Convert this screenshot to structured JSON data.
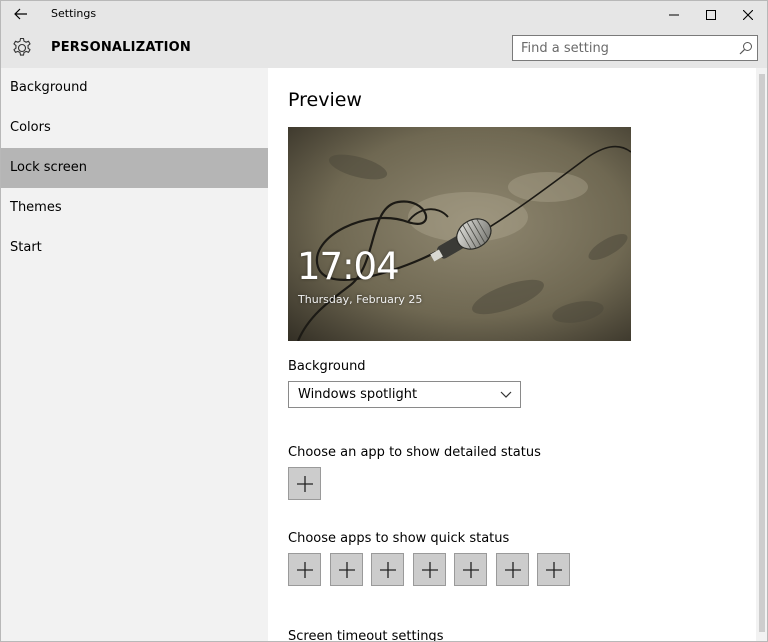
{
  "window": {
    "app_title": "Settings"
  },
  "header": {
    "title": "PERSONALIZATION",
    "search_placeholder": "Find a setting"
  },
  "sidebar": {
    "items": [
      {
        "label": "Background"
      },
      {
        "label": "Colors"
      },
      {
        "label": "Lock screen",
        "selected": true
      },
      {
        "label": "Themes"
      },
      {
        "label": "Start"
      }
    ]
  },
  "main": {
    "preview_heading": "Preview",
    "preview_time": "17:04",
    "preview_date": "Thursday, February 25",
    "background_label": "Background",
    "background_value": "Windows spotlight",
    "detailed_status_label": "Choose an app to show detailed status",
    "quick_status_label": "Choose apps to show quick status",
    "quick_status_slot_count": 7,
    "timeout_link": "Screen timeout settings"
  },
  "colors": {
    "titlebar_bg": "#e6e6e6",
    "sidebar_bg": "#f2f2f2",
    "selected_bg": "#b5b5b5",
    "plus_button_bg": "#cccccc"
  },
  "icons": {
    "back": "back-arrow-icon",
    "settings": "gear-icon",
    "search": "search-icon",
    "minimize": "minimize-icon",
    "maximize": "maximize-icon",
    "close": "close-icon",
    "dropdown": "chevron-down-icon",
    "add": "plus-icon"
  }
}
